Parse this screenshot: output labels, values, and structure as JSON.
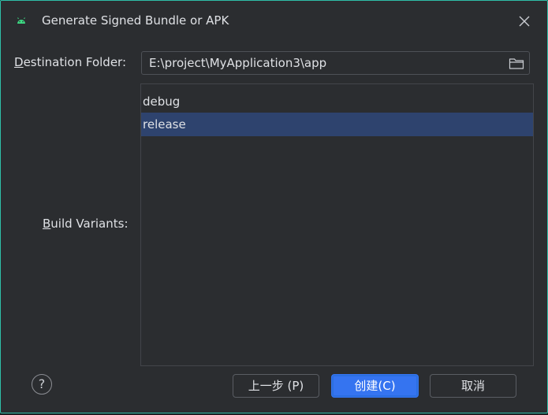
{
  "window": {
    "title": "Generate Signed Bundle or APK",
    "icon": "android-icon",
    "close_icon": "close-icon"
  },
  "destination": {
    "label_mnemonic": "D",
    "label_rest": "estination Folder:",
    "value": "E:\\project\\MyApplication3\\app",
    "browse_icon": "folder-icon"
  },
  "build_variants": {
    "label_mnemonic": "B",
    "label_rest": "uild Variants:",
    "items": [
      {
        "label": "debug",
        "selected": false
      },
      {
        "label": "release",
        "selected": true
      }
    ]
  },
  "footer": {
    "help": "?",
    "previous_label": "上一步 (P)",
    "create_label": "创建(C)",
    "cancel_label": "取消"
  },
  "colors": {
    "accent": "#3574f0",
    "selection": "#2e436e",
    "window_border": "#2fbfa8"
  }
}
